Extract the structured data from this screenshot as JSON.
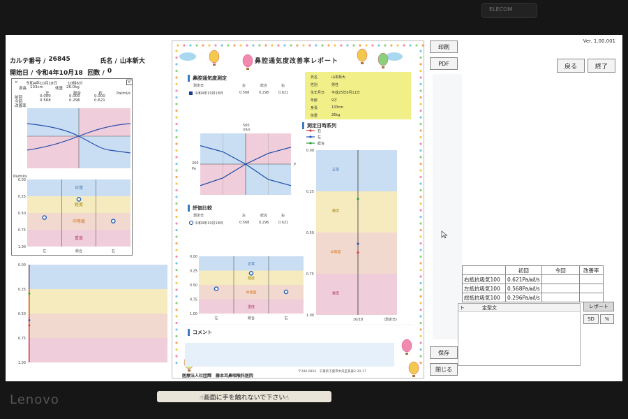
{
  "device": {
    "brand": "Lenovo",
    "webcam_label": "ELECOM",
    "sticker_text": "☝画面に手を触れないで下さい☝"
  },
  "app": {
    "version": "Ver. 1.00.001",
    "buttons": {
      "print": "印刷",
      "pdf": "PDF",
      "back": "戻る",
      "exit": "終了",
      "save": "保存",
      "close": "閉じる",
      "report": "レポート",
      "sd": "SD",
      "percent": "%"
    }
  },
  "patient": {
    "chart_no_label": "カルテ番号 /",
    "chart_no": "26845",
    "name_label": "氏名 /",
    "name": "山本新大",
    "start_label": "開始日 /",
    "start_date": "令和4年10月18日",
    "count_label": "回数 /",
    "count": "0"
  },
  "mini_panel": {
    "date": "令和4年10月18日",
    "time": "10時6分",
    "height_label": "身長",
    "height": "133cm",
    "weight_label": "体重",
    "weight": "26.0kg",
    "cols": [
      "左",
      "総合",
      "右"
    ],
    "unit": "Pa/ml/s",
    "rows": [
      {
        "label": "前回",
        "vals": [
          "0.000",
          "0.000",
          "0.000"
        ]
      },
      {
        "label": "今回",
        "vals": [
          "0.568",
          "0.296",
          "0.621"
        ]
      },
      {
        "label": "改善率",
        "vals": [
          "",
          "",
          ""
        ]
      }
    ],
    "close_icon": "×"
  },
  "report": {
    "title": "鼻腔通気度改善率レポート",
    "section_measure": "鼻腔通気度測定",
    "section_compare": "評価比較",
    "section_timeseries": "測定日時系列",
    "section_comment": "コメント",
    "table_headers": [
      "測定日",
      "左",
      "総合",
      "右"
    ],
    "table_row": [
      "令和4年10月18日",
      "0.568",
      "0.296",
      "0.621"
    ],
    "info": [
      {
        "k": "氏名",
        "v": "山本新大"
      },
      {
        "k": "性別",
        "v": "男性"
      },
      {
        "k": "生年月日",
        "v": "平成25年6月11日"
      },
      {
        "k": "年齢",
        "v": "9才"
      },
      {
        "k": "身長",
        "v": "133cm"
      },
      {
        "k": "体重",
        "v": "26kg"
      }
    ],
    "legend": [
      "右",
      "左",
      "総合"
    ],
    "legend_colors": [
      "#d23a3a",
      "#2a4fb0",
      "#2e9b3a"
    ],
    "flow_axis": {
      "top": "500",
      "top_unit": "ml/s",
      "left": "200",
      "left_unit": "Pa",
      "right_unit": "P"
    },
    "timeseries_date": "10/18",
    "timeseries_xlabel": "(測定日)",
    "footer_org": "医療法人社団輝　藤本耳鼻咽喉科医院",
    "footer_addr": "〒280-0854　千葉県千葉市中央区亥鼻2-20-17"
  },
  "levels": {
    "normal": "正常",
    "mild": "軽度",
    "moderate": "中等度",
    "severe": "重度",
    "left_cols": [
      "左",
      "総合",
      "右"
    ],
    "ticks": [
      "0.00",
      "0.25",
      "0.50",
      "0.75",
      "1.00"
    ],
    "unit": "Pa/ml/s",
    "colors": {
      "normal": "#c9def2",
      "mild": "#f5ebbf",
      "moderate": "#f2d9cf",
      "severe": "#f0cdda"
    }
  },
  "results": {
    "headers": [
      "",
      "初回",
      "今回",
      "改善率"
    ],
    "rows": [
      {
        "label": "右抵抗吸気100",
        "first": "0.621Pa/㎖/s"
      },
      {
        "label": "左抵抗吸気100",
        "first": "0.568Pa/㎖/s"
      },
      {
        "label": "総抵抗吸気100",
        "first": "0.296Pa/㎖/s"
      }
    ],
    "teikei_label": "定型文",
    "teikei_prefix": "ト"
  },
  "chart_data": [
    {
      "type": "scatter",
      "title": "評価比較",
      "categories": [
        "左",
        "総合",
        "右"
      ],
      "values": [
        0.568,
        0.296,
        0.621
      ],
      "ylim": [
        1.0,
        0.0
      ],
      "yticks": [
        "0.00",
        "0.25",
        "0.50",
        "0.75",
        "1.00"
      ]
    },
    {
      "type": "line",
      "title": "鼻腔通気度測定",
      "series": [
        {
          "name": "右",
          "values": [
            [
              -200,
              -140
            ],
            [
              -100,
              -90
            ],
            [
              0,
              0
            ],
            [
              100,
              70
            ],
            [
              200,
              110
            ]
          ]
        },
        {
          "name": "左",
          "values": [
            [
              -200,
              120
            ],
            [
              -100,
              80
            ],
            [
              0,
              0
            ],
            [
              100,
              -100
            ],
            [
              200,
              -140
            ]
          ]
        }
      ]
    },
    {
      "type": "scatter",
      "title": "測定日時系列",
      "x": [
        "10/18"
      ],
      "series": [
        {
          "name": "右",
          "values": [
            0.621
          ]
        },
        {
          "name": "左",
          "values": [
            0.568
          ]
        },
        {
          "name": "総合",
          "values": [
            0.296
          ]
        }
      ],
      "ylim": [
        1.0,
        0.0
      ]
    }
  ]
}
